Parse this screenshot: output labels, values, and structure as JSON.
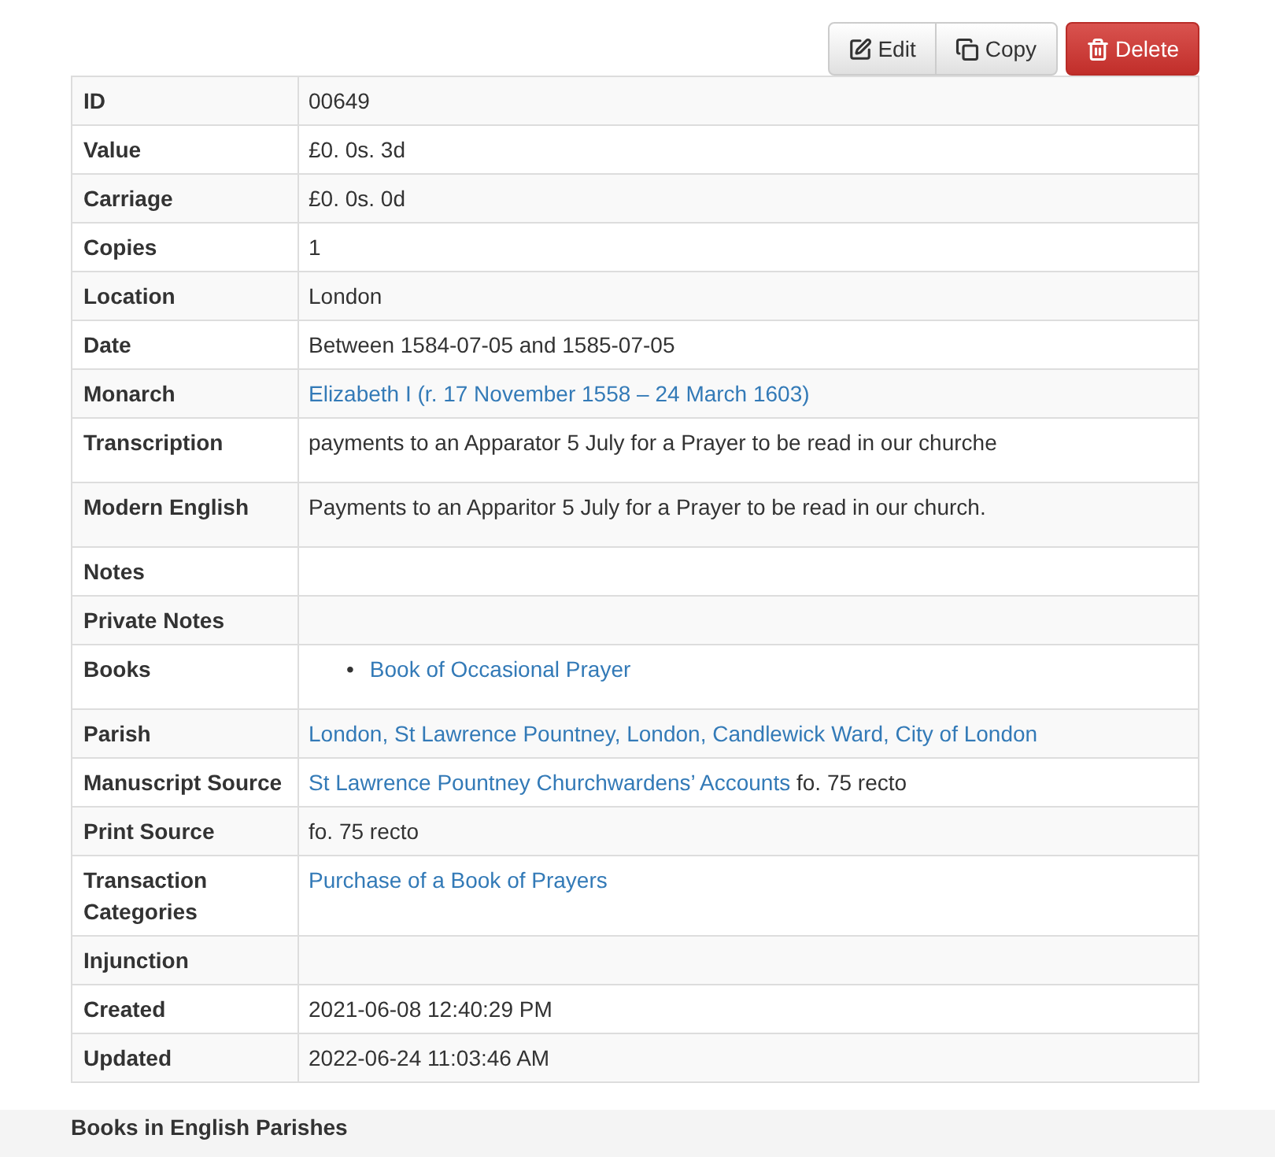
{
  "actions": [
    {
      "kind": "edit",
      "label": "Edit"
    },
    {
      "kind": "copy",
      "label": "Copy"
    },
    {
      "kind": "delete",
      "label": "Delete"
    }
  ],
  "rows": [
    {
      "label": "ID",
      "kind": "inline",
      "value": [
        {
          "kind": "text",
          "text": "00649"
        }
      ]
    },
    {
      "label": "Value",
      "kind": "inline",
      "value": [
        {
          "kind": "text",
          "text": "£0. 0s. 3d"
        }
      ]
    },
    {
      "label": "Carriage",
      "kind": "inline",
      "value": [
        {
          "kind": "text",
          "text": "£0. 0s. 0d"
        }
      ]
    },
    {
      "label": "Copies",
      "kind": "inline",
      "value": [
        {
          "kind": "text",
          "text": "1"
        }
      ]
    },
    {
      "label": "Location",
      "kind": "inline",
      "value": [
        {
          "kind": "text",
          "text": "London"
        }
      ]
    },
    {
      "label": "Date",
      "kind": "inline",
      "value": [
        {
          "kind": "text",
          "text": "Between 1584-07-05 and 1585-07-05"
        }
      ]
    },
    {
      "label": "Monarch",
      "kind": "inline",
      "value": [
        {
          "kind": "link",
          "text": "Elizabeth I (r. 17 November 1558 – 24 March 1603)"
        }
      ]
    },
    {
      "label": "Transcription",
      "kind": "paragraph",
      "value": [
        {
          "kind": "text",
          "text": "payments to an Apparator 5 July for a Prayer to be read in our churche"
        }
      ]
    },
    {
      "label": "Modern English",
      "kind": "paragraph",
      "value": [
        {
          "kind": "text",
          "text": "Payments to an Apparitor 5 July for a Prayer to be read in our church."
        }
      ]
    },
    {
      "label": "Notes",
      "kind": "inline",
      "value": []
    },
    {
      "label": "Private Notes",
      "kind": "inline",
      "value": []
    },
    {
      "label": "Books",
      "kind": "list",
      "value": [
        {
          "kind": "link",
          "text": "Book of Occasional Prayer",
          "marker": "•"
        }
      ]
    },
    {
      "label": "Parish",
      "kind": "inline",
      "value": [
        {
          "kind": "link",
          "text": "London, St Lawrence Pountney, London, Candlewick Ward, City of London"
        }
      ]
    },
    {
      "label": "Manuscript Source",
      "kind": "inline",
      "value": [
        {
          "kind": "link",
          "text": "St Lawrence Pountney Churchwardens’ Accounts"
        },
        {
          "kind": "text",
          "text": "fo. 75 recto"
        }
      ]
    },
    {
      "label": "Print Source",
      "kind": "inline",
      "value": [
        {
          "kind": "text",
          "text": "fo. 75 recto"
        }
      ]
    },
    {
      "label": "Transaction Categories",
      "kind": "inline",
      "value": [
        {
          "kind": "link",
          "text": "Purchase of a Book of Prayers"
        }
      ]
    },
    {
      "label": "Injunction",
      "kind": "inline",
      "value": []
    },
    {
      "label": "Created",
      "kind": "inline",
      "value": [
        {
          "kind": "text",
          "text": "2021-06-08 12:40:29 PM"
        }
      ]
    },
    {
      "label": "Updated",
      "kind": "inline",
      "value": [
        {
          "kind": "text",
          "text": "2022-06-24 11:03:46 AM"
        }
      ]
    }
  ],
  "footer": {
    "title": "Books in English Parishes"
  }
}
